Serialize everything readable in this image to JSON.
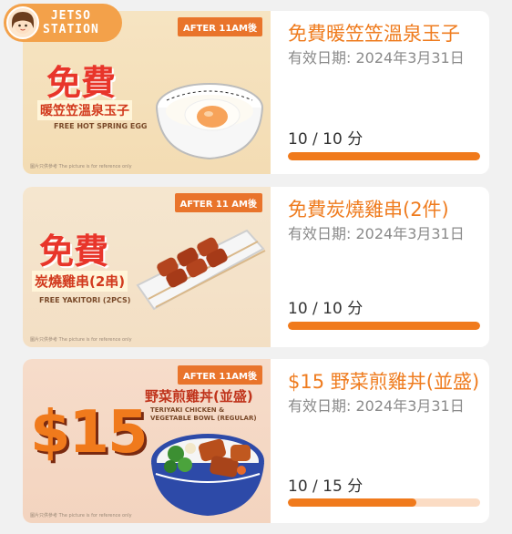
{
  "logo": {
    "line1": "JETSO",
    "line2": "STATION"
  },
  "coupons": [
    {
      "title": "免費暖笠笠溫泉玉子",
      "validity": "有效日期: 2024年3月31日",
      "count": "10 / 10 分",
      "progress": 1.0,
      "image": {
        "tag": "AFTER 11AM後",
        "big": "免費",
        "sub": "暖笠笠溫泉玉子",
        "en": "FREE HOT SPRING EGG",
        "fine": "圖片只供參考 The picture is for reference only"
      }
    },
    {
      "title": "免費炭燒雞串(2件)",
      "validity": "有效日期: 2024年3月31日",
      "count": "10 / 10 分",
      "progress": 1.0,
      "image": {
        "tag": "AFTER 11 AM後",
        "big": "免費",
        "sub": "炭燒雞串(2串)",
        "en": "FREE YAKITORI (2PCS)",
        "fine": "圖片只供參考 The picture is for reference only"
      }
    },
    {
      "title": "$15 野菜煎雞丼(並盛)",
      "validity": "有效日期: 2024年3月31日",
      "count": "10 / 15 分",
      "progress": 0.6667,
      "image": {
        "tag": "AFTER 11AM後",
        "big": "$15",
        "sub": "野菜煎雞丼(並盛)",
        "en": "TERIYAKI CHICKEN & VEGETABLE BOWL (REGULAR)",
        "fine": "圖片只供參考 The picture is for reference only"
      }
    }
  ],
  "colors": {
    "accent": "#ef7c1f",
    "bar_fill": "#f07a1c",
    "bar_track": "#fbdcc4",
    "promo_red": "#e8352a"
  }
}
